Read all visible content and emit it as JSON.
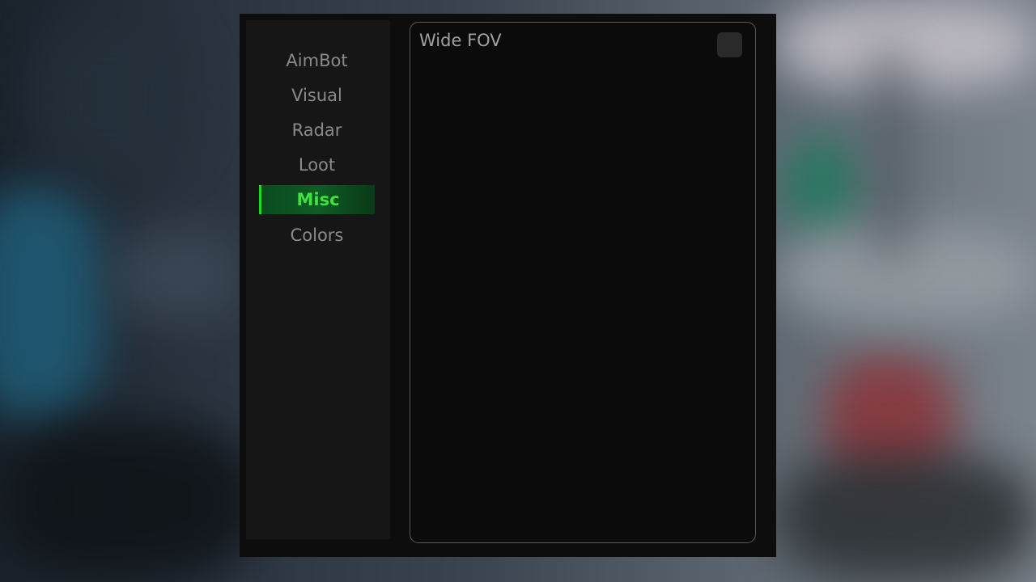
{
  "sidebar": {
    "items": [
      {
        "label": "AimBot",
        "active": false
      },
      {
        "label": "Visual",
        "active": false
      },
      {
        "label": "Radar",
        "active": false
      },
      {
        "label": "Loot",
        "active": false
      },
      {
        "label": "Misc",
        "active": true
      },
      {
        "label": "Colors",
        "active": false
      }
    ]
  },
  "misc": {
    "options": [
      {
        "label": "Wide FOV",
        "checked": false
      }
    ]
  },
  "colors": {
    "accent": "#22d62e",
    "active_text": "#3fe23f",
    "text": "#8a8a8a",
    "window_bg": "#0d0d0d",
    "sidebar_bg": "#161616",
    "panel_border": "#5a5a5a",
    "checkbox_bg": "#2a2a2a"
  }
}
